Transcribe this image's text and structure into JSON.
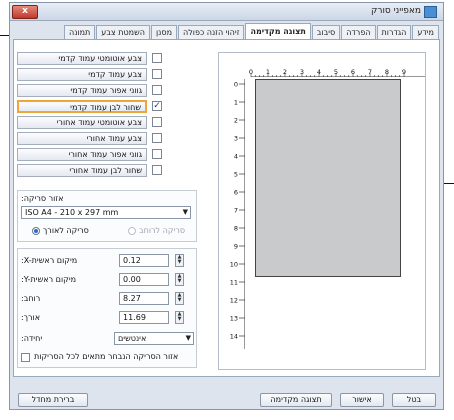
{
  "window": {
    "title": "מאפייני סורק",
    "close_label": "x"
  },
  "tabs": [
    "מידע",
    "הגדרות",
    "הפרדה",
    "סיבוב",
    "תצוגה מקדימה",
    "זיהוי הזנה כפולה",
    "מסנן",
    "השמטת צבע",
    "תמונה"
  ],
  "area_list": [
    {
      "label": "צבע אוטומטי עמוד קדמי",
      "checked": false,
      "selected": false
    },
    {
      "label": "צבע עמוד קדמי",
      "checked": false,
      "selected": false
    },
    {
      "label": "גווני אפור עמוד קדמי",
      "checked": false,
      "selected": false
    },
    {
      "label": "שחור לבן עמוד קדמי",
      "checked": true,
      "selected": true
    },
    {
      "label": "צבע אוטומטי עמוד אחורי",
      "checked": false,
      "selected": false
    },
    {
      "label": "צבע עמוד אחורי",
      "checked": false,
      "selected": false
    },
    {
      "label": "גווני אפור עמוד אחורי",
      "checked": false,
      "selected": false
    },
    {
      "label": "שחור לבן עמוד אחורי",
      "checked": false,
      "selected": false
    }
  ],
  "scan_area": {
    "label": ":אזור סריקה",
    "selected": "ISO A4 - 210 x 297 mm",
    "orientation_width": "סריקה לרוחב",
    "orientation_length": "סריקה לאורך"
  },
  "offsets": {
    "x_label": ":X-מיקום ראשית",
    "x_value": "0.12",
    "y_label": ":Y-מיקום ראשית",
    "y_value": "0.00",
    "width_label": ":רוחב",
    "width_value": "8.27",
    "length_label": ":אורך",
    "length_value": "11.69",
    "unit_label": ":יחידה",
    "unit_value": "אינטשים",
    "fit_label": "אזור הסריקה הנבחר מתאים לכל הסריקות"
  },
  "ruler": {
    "top": [
      "0",
      "1",
      "2",
      "3",
      "4",
      "5",
      "6",
      "7",
      "8",
      "9"
    ],
    "left": [
      "0",
      "1",
      "2",
      "3",
      "4",
      "5",
      "6",
      "7",
      "8",
      "9",
      "10",
      "11",
      "12",
      "13",
      "14"
    ]
  },
  "buttons": {
    "default": "ברירת מחדל",
    "preview": "תצוגה מקדימה",
    "ok": "אישור",
    "cancel": "בטל"
  }
}
